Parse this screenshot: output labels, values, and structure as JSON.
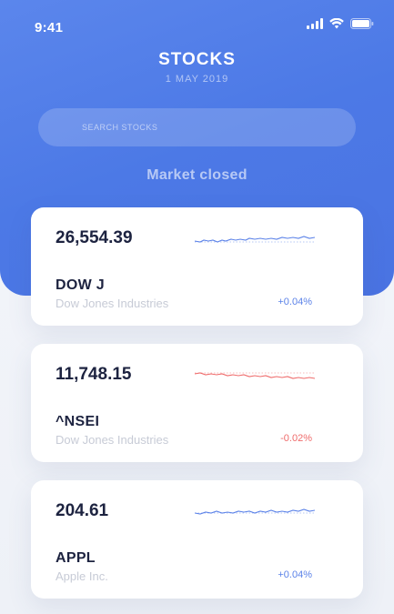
{
  "status_bar": {
    "time": "9:41",
    "icons": [
      "signal-icon",
      "wifi-icon",
      "battery-icon"
    ]
  },
  "header": {
    "title": "STOCKS",
    "date": "1 MAY 2019"
  },
  "search": {
    "placeholder": "SEARCH STOCKS",
    "value": ""
  },
  "market_status": "Market closed",
  "colors": {
    "header_gradient_start": "#5b86ec",
    "header_gradient_end": "#4a73e2",
    "positive": "#5b82e8",
    "negative": "#ef6b6b",
    "text_dark": "#1d2340",
    "text_muted": "#c7cbd6"
  },
  "stocks": [
    {
      "price": "26,554.39",
      "symbol": "DOW J",
      "name": "Dow Jones Industries",
      "change": "+0.04%",
      "trend": "positive"
    },
    {
      "price": "11,748.15",
      "symbol": "^NSEI",
      "name": "Dow Jones Industries",
      "change": "-0.02%",
      "trend": "negative"
    },
    {
      "price": "204.61",
      "symbol": "APPL",
      "name": "Apple Inc.",
      "change": "+0.04%",
      "trend": "positive"
    }
  ]
}
